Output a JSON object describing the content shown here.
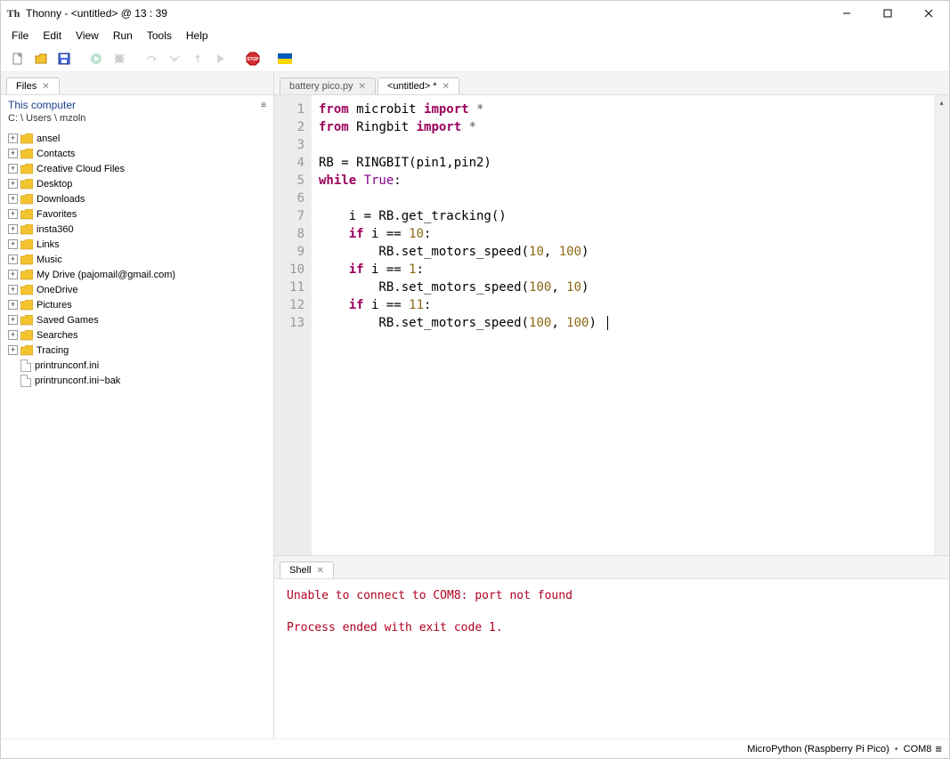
{
  "title": "Thonny  -  <untitled>  @  13 : 39",
  "menu": [
    "File",
    "Edit",
    "View",
    "Run",
    "Tools",
    "Help"
  ],
  "files_tab": "Files",
  "files_header": "This computer",
  "files_path": "C: \\ Users \\ mzoln",
  "tree": [
    {
      "type": "folder",
      "label": "ansel"
    },
    {
      "type": "folder",
      "label": "Contacts"
    },
    {
      "type": "folder",
      "label": "Creative Cloud Files"
    },
    {
      "type": "folder",
      "label": "Desktop"
    },
    {
      "type": "folder",
      "label": "Downloads"
    },
    {
      "type": "folder",
      "label": "Favorites"
    },
    {
      "type": "folder",
      "label": "insta360"
    },
    {
      "type": "folder",
      "label": "Links"
    },
    {
      "type": "folder",
      "label": "Music"
    },
    {
      "type": "folder",
      "label": "My Drive (pajomail@gmail.com)"
    },
    {
      "type": "folder",
      "label": "OneDrive"
    },
    {
      "type": "folder",
      "label": "Pictures"
    },
    {
      "type": "folder",
      "label": "Saved Games"
    },
    {
      "type": "folder",
      "label": "Searches"
    },
    {
      "type": "folder",
      "label": "Tracing"
    },
    {
      "type": "file",
      "label": "printrunconf.ini"
    },
    {
      "type": "file",
      "label": "printrunconf.ini~bak"
    }
  ],
  "editor_tabs": [
    {
      "label": "battery pico.py",
      "active": false,
      "close": true
    },
    {
      "label": "<untitled> *",
      "active": true,
      "close": true
    }
  ],
  "line_numbers": [
    "1",
    "2",
    "3",
    "4",
    "5",
    "6",
    "7",
    "8",
    "9",
    "10",
    "11",
    "12",
    "13"
  ],
  "code_lines": [
    [
      {
        "t": "from ",
        "c": "kw"
      },
      {
        "t": "microbit ",
        "c": "name"
      },
      {
        "t": "import ",
        "c": "kw"
      },
      {
        "t": "*",
        "c": "op"
      }
    ],
    [
      {
        "t": "from ",
        "c": "kw"
      },
      {
        "t": "Ringbit ",
        "c": "name"
      },
      {
        "t": "import ",
        "c": "kw"
      },
      {
        "t": "*",
        "c": "op"
      }
    ],
    [],
    [
      {
        "t": "RB = RINGBIT(pin1,pin2)",
        "c": "name"
      }
    ],
    [
      {
        "t": "while ",
        "c": "kw"
      },
      {
        "t": "True",
        "c": "builtin"
      },
      {
        "t": ":",
        "c": "name"
      }
    ],
    [],
    [
      {
        "t": "    i = RB.get_tracking()",
        "c": "name"
      }
    ],
    [
      {
        "t": "    ",
        "c": "name"
      },
      {
        "t": "if ",
        "c": "kw"
      },
      {
        "t": "i == ",
        "c": "name"
      },
      {
        "t": "10",
        "c": "num"
      },
      {
        "t": ":",
        "c": "name"
      }
    ],
    [
      {
        "t": "        RB.set_motors_speed(",
        "c": "name"
      },
      {
        "t": "10",
        "c": "num"
      },
      {
        "t": ", ",
        "c": "name"
      },
      {
        "t": "100",
        "c": "num"
      },
      {
        "t": ")",
        "c": "name"
      }
    ],
    [
      {
        "t": "    ",
        "c": "name"
      },
      {
        "t": "if ",
        "c": "kw"
      },
      {
        "t": "i == ",
        "c": "name"
      },
      {
        "t": "1",
        "c": "num"
      },
      {
        "t": ":",
        "c": "name"
      }
    ],
    [
      {
        "t": "        RB.set_motors_speed(",
        "c": "name"
      },
      {
        "t": "100",
        "c": "num"
      },
      {
        "t": ", ",
        "c": "name"
      },
      {
        "t": "10",
        "c": "num"
      },
      {
        "t": ")",
        "c": "name"
      }
    ],
    [
      {
        "t": "    ",
        "c": "name"
      },
      {
        "t": "if ",
        "c": "kw"
      },
      {
        "t": "i == ",
        "c": "name"
      },
      {
        "t": "11",
        "c": "num"
      },
      {
        "t": ":",
        "c": "name"
      }
    ],
    [
      {
        "t": "        RB.set_motors_speed(",
        "c": "name"
      },
      {
        "t": "100",
        "c": "num"
      },
      {
        "t": ", ",
        "c": "name"
      },
      {
        "t": "100",
        "c": "num"
      },
      {
        "t": ") ",
        "c": "name"
      }
    ]
  ],
  "shell_tab": "Shell",
  "shell_output": "Unable to connect to COM8: port not found\n\nProcess ended with exit code 1.",
  "status_interpreter": "MicroPython (Raspberry Pi Pico)",
  "status_port": "COM8"
}
